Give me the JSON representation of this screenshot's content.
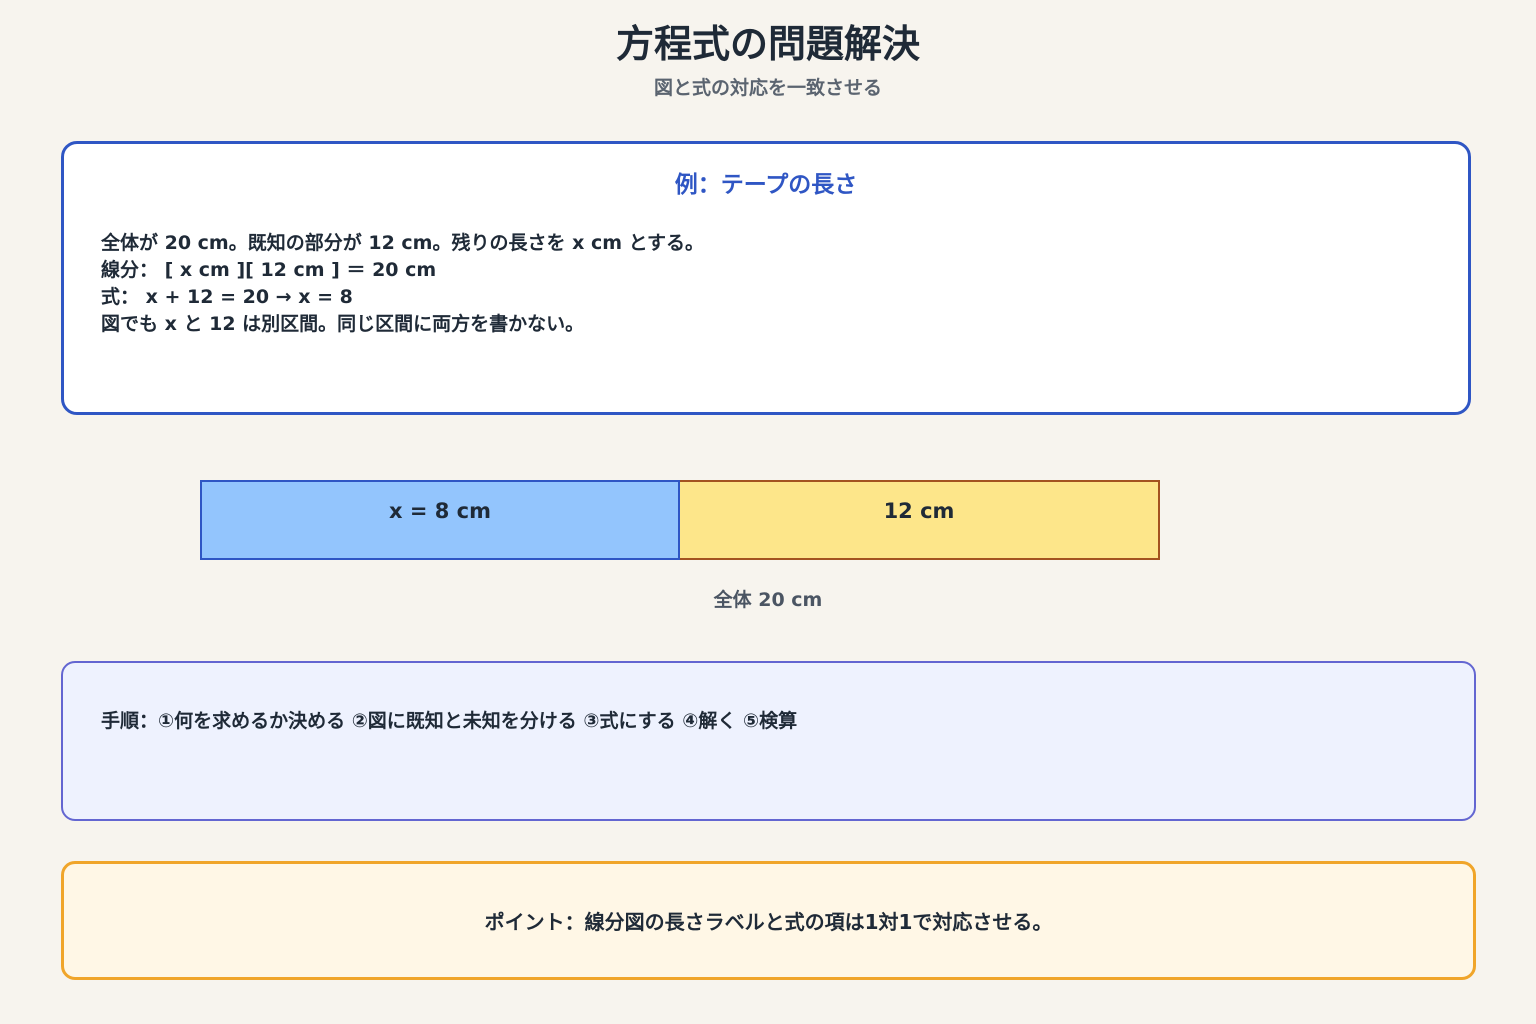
{
  "header": {
    "title": "方程式の問題解決",
    "subtitle": "図と式の対応を一致させる"
  },
  "example": {
    "title": "例：テープの長さ",
    "lines": [
      "全体が 20 cm。既知の部分が 12 cm。残りの長さを x cm とする。",
      "線分： [ x cm ][ 12 cm ] ＝ 20 cm",
      "式： x + 12 = 20 → x = 8",
      "図でも x と 12 は別区間。同じ区間に両方を書かない。"
    ]
  },
  "tape_diagram": {
    "unknown_label": "x = 8 cm",
    "known_label": "12 cm",
    "total_label": "全体 20 cm",
    "unknown_value": 8,
    "known_value": 12,
    "total_value": 20,
    "colors": {
      "unknown_fill": "#93c5fd",
      "unknown_border": "#2f56c4",
      "known_fill": "#fde68a",
      "known_border": "#a3531f"
    }
  },
  "steps": {
    "text": "手順：①何を求めるか決める ②図に既知と未知を分ける ③式にする ④解く ⑤検算"
  },
  "point": {
    "text": "ポイント：線分図の長さラベルと式の項は1対1で対応させる。"
  },
  "colors": {
    "background": "#f7f4ee",
    "accent_blue": "#2f56c4",
    "steps_border": "#6366d1",
    "point_border": "#f0a52a"
  }
}
